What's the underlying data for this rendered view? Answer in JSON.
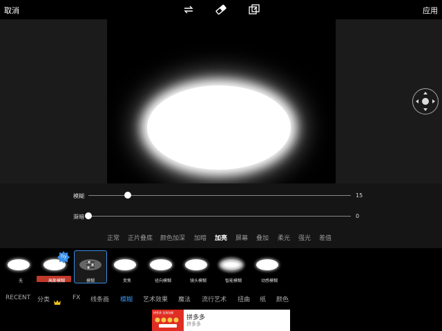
{
  "topbar": {
    "cancel": "取消",
    "apply": "应用"
  },
  "sliders": [
    {
      "label": "模糊",
      "value": "15",
      "fraction": 0.15
    },
    {
      "label": "渐暗",
      "value": "0",
      "fraction": 0.0
    }
  ],
  "blend_modes": [
    "正常",
    "正片叠底",
    "颜色加深",
    "加暗",
    "加亮",
    "屏幕",
    "叠加",
    "柔光",
    "强光",
    "差值"
  ],
  "blend_active": "加亮",
  "filters": [
    {
      "label": "无"
    },
    {
      "label": "高斯模糊",
      "badge": "Try"
    },
    {
      "label": "模糊",
      "selected": true
    },
    {
      "label": "变焦"
    },
    {
      "label": "径向模糊"
    },
    {
      "label": "镜头模糊"
    },
    {
      "label": "智能模糊"
    },
    {
      "label": "动感模糊"
    }
  ],
  "categories": [
    "RECENT",
    "分类",
    "FX",
    "线条画",
    "模糊",
    "艺术效果",
    "魔法",
    "流行艺术",
    "扭曲",
    "纸",
    "颜色"
  ],
  "category_active": "模糊",
  "ad": {
    "title": "拼多多",
    "subtitle": "拼多多",
    "banner": "拼多多 全场包邮"
  },
  "colors": {
    "accent": "#3a8ee6",
    "badge_bar": "#c0392b"
  }
}
